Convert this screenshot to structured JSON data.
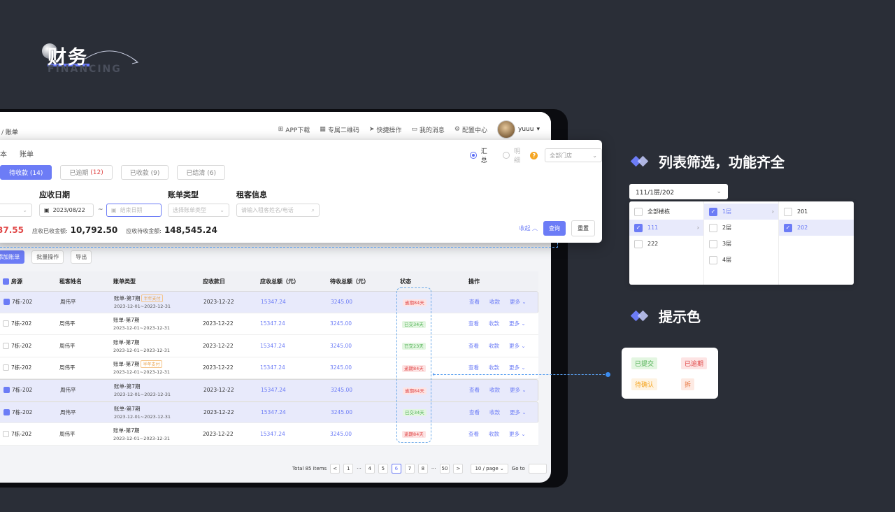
{
  "logo": {
    "cn": "财务",
    "en": "FINANCING"
  },
  "breadcrumb": {
    "sep": "/",
    "current": "账单"
  },
  "topnav": {
    "app": "APP下载",
    "qr": "专属二维码",
    "quick": "快捷操作",
    "msg": "我的消息",
    "config": "配置中心",
    "user": "yuuu"
  },
  "subtabs": [
    "本",
    "账单"
  ],
  "view": {
    "summary": "汇总",
    "detail": "明细",
    "store_placeholder": "全部门店"
  },
  "status_tabs": [
    {
      "label": "待收款 (14)"
    },
    {
      "label": "已逾期",
      "count": "(12)"
    },
    {
      "label": "已收款 (9)"
    },
    {
      "label": "已结清 (6)"
    }
  ],
  "filters": {
    "due_date": "应收日期",
    "bill_type": "账单类型",
    "tenant": "租客信息",
    "start_date": "2023/08/22",
    "tilde": "~",
    "end_placeholder": "结束日期",
    "type_placeholder": "选择账单类型",
    "tenant_placeholder": "请输入租客姓名/电话"
  },
  "summary": {
    "total_tail": "37.55",
    "received_label": "应收已收金额:",
    "received": "10,792.50",
    "pending_label": "应收待收金额:",
    "pending": "148,545.24"
  },
  "buttons": {
    "collapse": "收起",
    "query": "查询",
    "reset": "重置",
    "add": "+ 添加账单",
    "batch": "批量操作",
    "export": "导出"
  },
  "columns": [
    "房源",
    "租客姓名",
    "账单类型",
    "应收款日",
    "应收总额（元）",
    "待收总额（元）",
    "状态",
    "操作"
  ],
  "rows": [
    {
      "room": "7栋-202",
      "tenant": "周伟平",
      "bill": "账单-第7期",
      "badge": "半年支付",
      "period": "2023-12-01~2023-12-31",
      "due": "2023-12-22",
      "total": "15347.24",
      "pending": "3245.00",
      "status": "逾期84天",
      "status_type": "red",
      "selected": true
    },
    {
      "room": "7栋-202",
      "tenant": "周伟平",
      "bill": "账单-第7期",
      "badge": "",
      "period": "2023-12-01~2023-12-31",
      "due": "2023-12-22",
      "total": "15347.24",
      "pending": "3245.00",
      "status": "已交34天",
      "status_type": "green",
      "selected": false
    },
    {
      "room": "7栋-202",
      "tenant": "周伟平",
      "bill": "账单-第7期",
      "badge": "",
      "period": "2023-12-01~2023-12-31",
      "due": "2023-12-22",
      "total": "15347.24",
      "pending": "3245.00",
      "status": "已交23天",
      "status_type": "green",
      "selected": false
    },
    {
      "room": "7栋-202",
      "tenant": "周伟平",
      "bill": "账单-第7期",
      "badge": "半年支付",
      "period": "2023-12-01~2023-12-31",
      "due": "2023-12-22",
      "total": "15347.24",
      "pending": "3245.00",
      "status": "逾期84天",
      "status_type": "red",
      "selected": false
    },
    {
      "room": "7栋-202",
      "tenant": "周伟平",
      "bill": "账单-第7期",
      "badge": "",
      "period": "2023-12-01~2023-12-31",
      "due": "2023-12-22",
      "total": "15347.24",
      "pending": "3245.00",
      "status": "逾期84天",
      "status_type": "red",
      "selected": true
    },
    {
      "room": "7栋-202",
      "tenant": "周伟平",
      "bill": "账单-第7期",
      "badge": "",
      "period": "2023-12-01~2023-12-31",
      "due": "2023-12-22",
      "total": "15347.24",
      "pending": "3245.00",
      "status": "已交34天",
      "status_type": "green",
      "selected": true
    },
    {
      "room": "7栋-202",
      "tenant": "周伟平",
      "bill": "账单-第7期",
      "badge": "",
      "period": "2023-12-01~2023-12-31",
      "due": "2023-12-22",
      "total": "15347.24",
      "pending": "3245.00",
      "status": "逾期84天",
      "status_type": "red",
      "selected": false
    }
  ],
  "row_ops": {
    "view": "查看",
    "collect": "收款",
    "more": "更多"
  },
  "pagination": {
    "total": "Total 85 items",
    "prev": "<",
    "next": ">",
    "ellipsis": "···",
    "pages": [
      "1",
      "4",
      "5",
      "6",
      "7",
      "8",
      "50"
    ],
    "current": "6",
    "size": "10 / page",
    "goto": "Go to"
  },
  "right": {
    "heading1": "列表筛选，功能齐全",
    "heading2": "提示色"
  },
  "cascade": {
    "value": "111/1层/202",
    "col1": [
      {
        "label": "全部楼栋",
        "checked": false,
        "active": false
      },
      {
        "label": "111",
        "checked": true,
        "active": true
      },
      {
        "label": "222",
        "checked": false,
        "active": false
      }
    ],
    "col2": [
      {
        "label": "1层",
        "checked": true,
        "active": true
      },
      {
        "label": "2层",
        "checked": false,
        "active": false
      },
      {
        "label": "3层",
        "checked": false,
        "active": false
      },
      {
        "label": "4层",
        "checked": false,
        "active": false
      }
    ],
    "col3": [
      {
        "label": "201",
        "checked": false,
        "active": false
      },
      {
        "label": "202",
        "checked": true,
        "active": true
      }
    ]
  },
  "tags": {
    "submitted": "已提交",
    "overdue": "已逾期",
    "pending": "待确认",
    "demolish": "拆"
  },
  "colors": {
    "accent": "#6c7cf6",
    "red": "#e04545",
    "green": "#4caf50",
    "orange": "#f5a623",
    "bg": "#2a2e37"
  }
}
